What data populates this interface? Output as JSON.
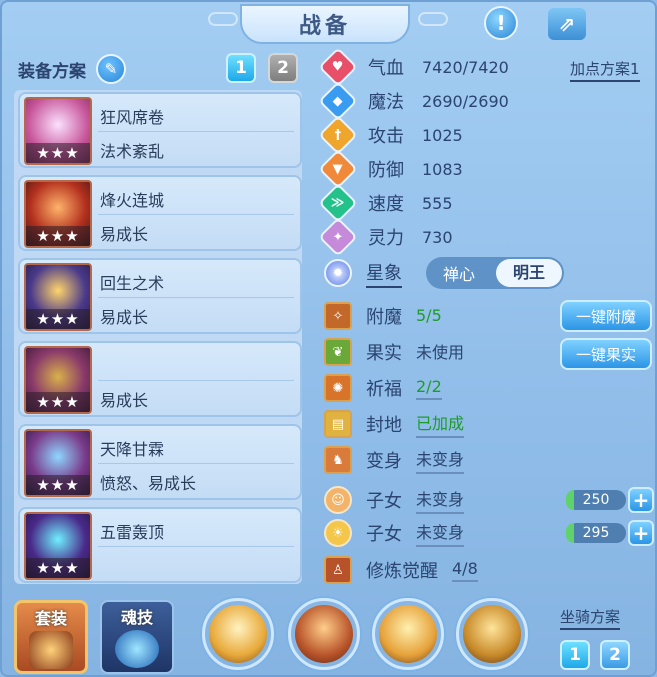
{
  "title": "战备",
  "header_icons": {
    "help": "exclamation-icon",
    "share": "share-icon"
  },
  "equip_plan": {
    "label": "装备方案",
    "buttons": [
      "1",
      "2"
    ],
    "items": [
      {
        "name": "狂风席卷",
        "desc": "法术紊乱",
        "stars": "★★★",
        "icon": "bolt-wand-icon"
      },
      {
        "name": "烽火连城",
        "desc": "易成长",
        "stars": "★★★",
        "icon": "flame-artifact-icon"
      },
      {
        "name": "回生之术",
        "desc": "易成长",
        "stars": "★★★",
        "icon": "revive-mask-icon"
      },
      {
        "name": "",
        "desc": "易成长",
        "stars": "★★★",
        "icon": "necklace-icon"
      },
      {
        "name": "天降甘霖",
        "desc": "愤怒、易成长",
        "stars": "★★★",
        "icon": "rain-ring-icon"
      },
      {
        "name": "五雷轰顶",
        "desc": "",
        "stars": "★★★",
        "icon": "thunder-armor-icon"
      }
    ]
  },
  "point_plan": {
    "label": "加点方案1"
  },
  "stats": [
    {
      "label": "气血",
      "value": "7420/7420",
      "color": "#e8506a",
      "icon": "heart-icon"
    },
    {
      "label": "魔法",
      "value": "2690/2690",
      "color": "#3a9cf0",
      "icon": "mana-icon"
    },
    {
      "label": "攻击",
      "value": "1025",
      "color": "#f0a52c",
      "icon": "sword-icon"
    },
    {
      "label": "防御",
      "value": "1083",
      "color": "#f08a3a",
      "icon": "shield-icon"
    },
    {
      "label": "速度",
      "value": "555",
      "color": "#23c28a",
      "icon": "speed-icon"
    },
    {
      "label": "灵力",
      "value": "730",
      "color": "#c58ad9",
      "icon": "spirit-icon"
    }
  ],
  "xingxiang": {
    "label": "星象",
    "options": [
      "禅心",
      "明王"
    ],
    "selected": "明王"
  },
  "subs": [
    {
      "label": "附魔",
      "value": "5/5",
      "green": true,
      "underline": false,
      "icon": "enchant-icon",
      "bg": "#c2682a"
    },
    {
      "label": "果实",
      "value": "未使用",
      "green": false,
      "underline": false,
      "icon": "fruit-icon",
      "bg": "#6aa83a"
    },
    {
      "label": "祈福",
      "value": "2/2",
      "green": true,
      "underline": true,
      "icon": "bless-icon",
      "bg": "#d8732a"
    },
    {
      "label": "封地",
      "value": "已加成",
      "green": true,
      "underline": true,
      "icon": "scroll-icon",
      "bg": "#e0b340"
    },
    {
      "label": "变身",
      "value": "未变身",
      "green": false,
      "underline": true,
      "icon": "transform-icon",
      "bg": "#d97b3a"
    },
    {
      "label": "子女",
      "value": "未变身",
      "green": false,
      "underline": true,
      "icon": "child-boy-icon",
      "bg": "#f3b46a"
    },
    {
      "label": "子女",
      "value": "未变身",
      "green": false,
      "underline": true,
      "icon": "child-girl-icon",
      "bg": "#f4c64a"
    },
    {
      "label": "修炼觉醒",
      "value": "4/8",
      "green": false,
      "underline": true,
      "icon": "cultivate-icon",
      "bg": "#b8522a"
    }
  ],
  "actions": {
    "enchant": "一键附魔",
    "fruit": "一键果实"
  },
  "sliders": [
    "250",
    "295"
  ],
  "bottom": {
    "tab_suit": "套装",
    "tab_soul": "魂技",
    "mount_label": "坐骑方案",
    "mount_buttons": [
      "1",
      "2"
    ]
  }
}
